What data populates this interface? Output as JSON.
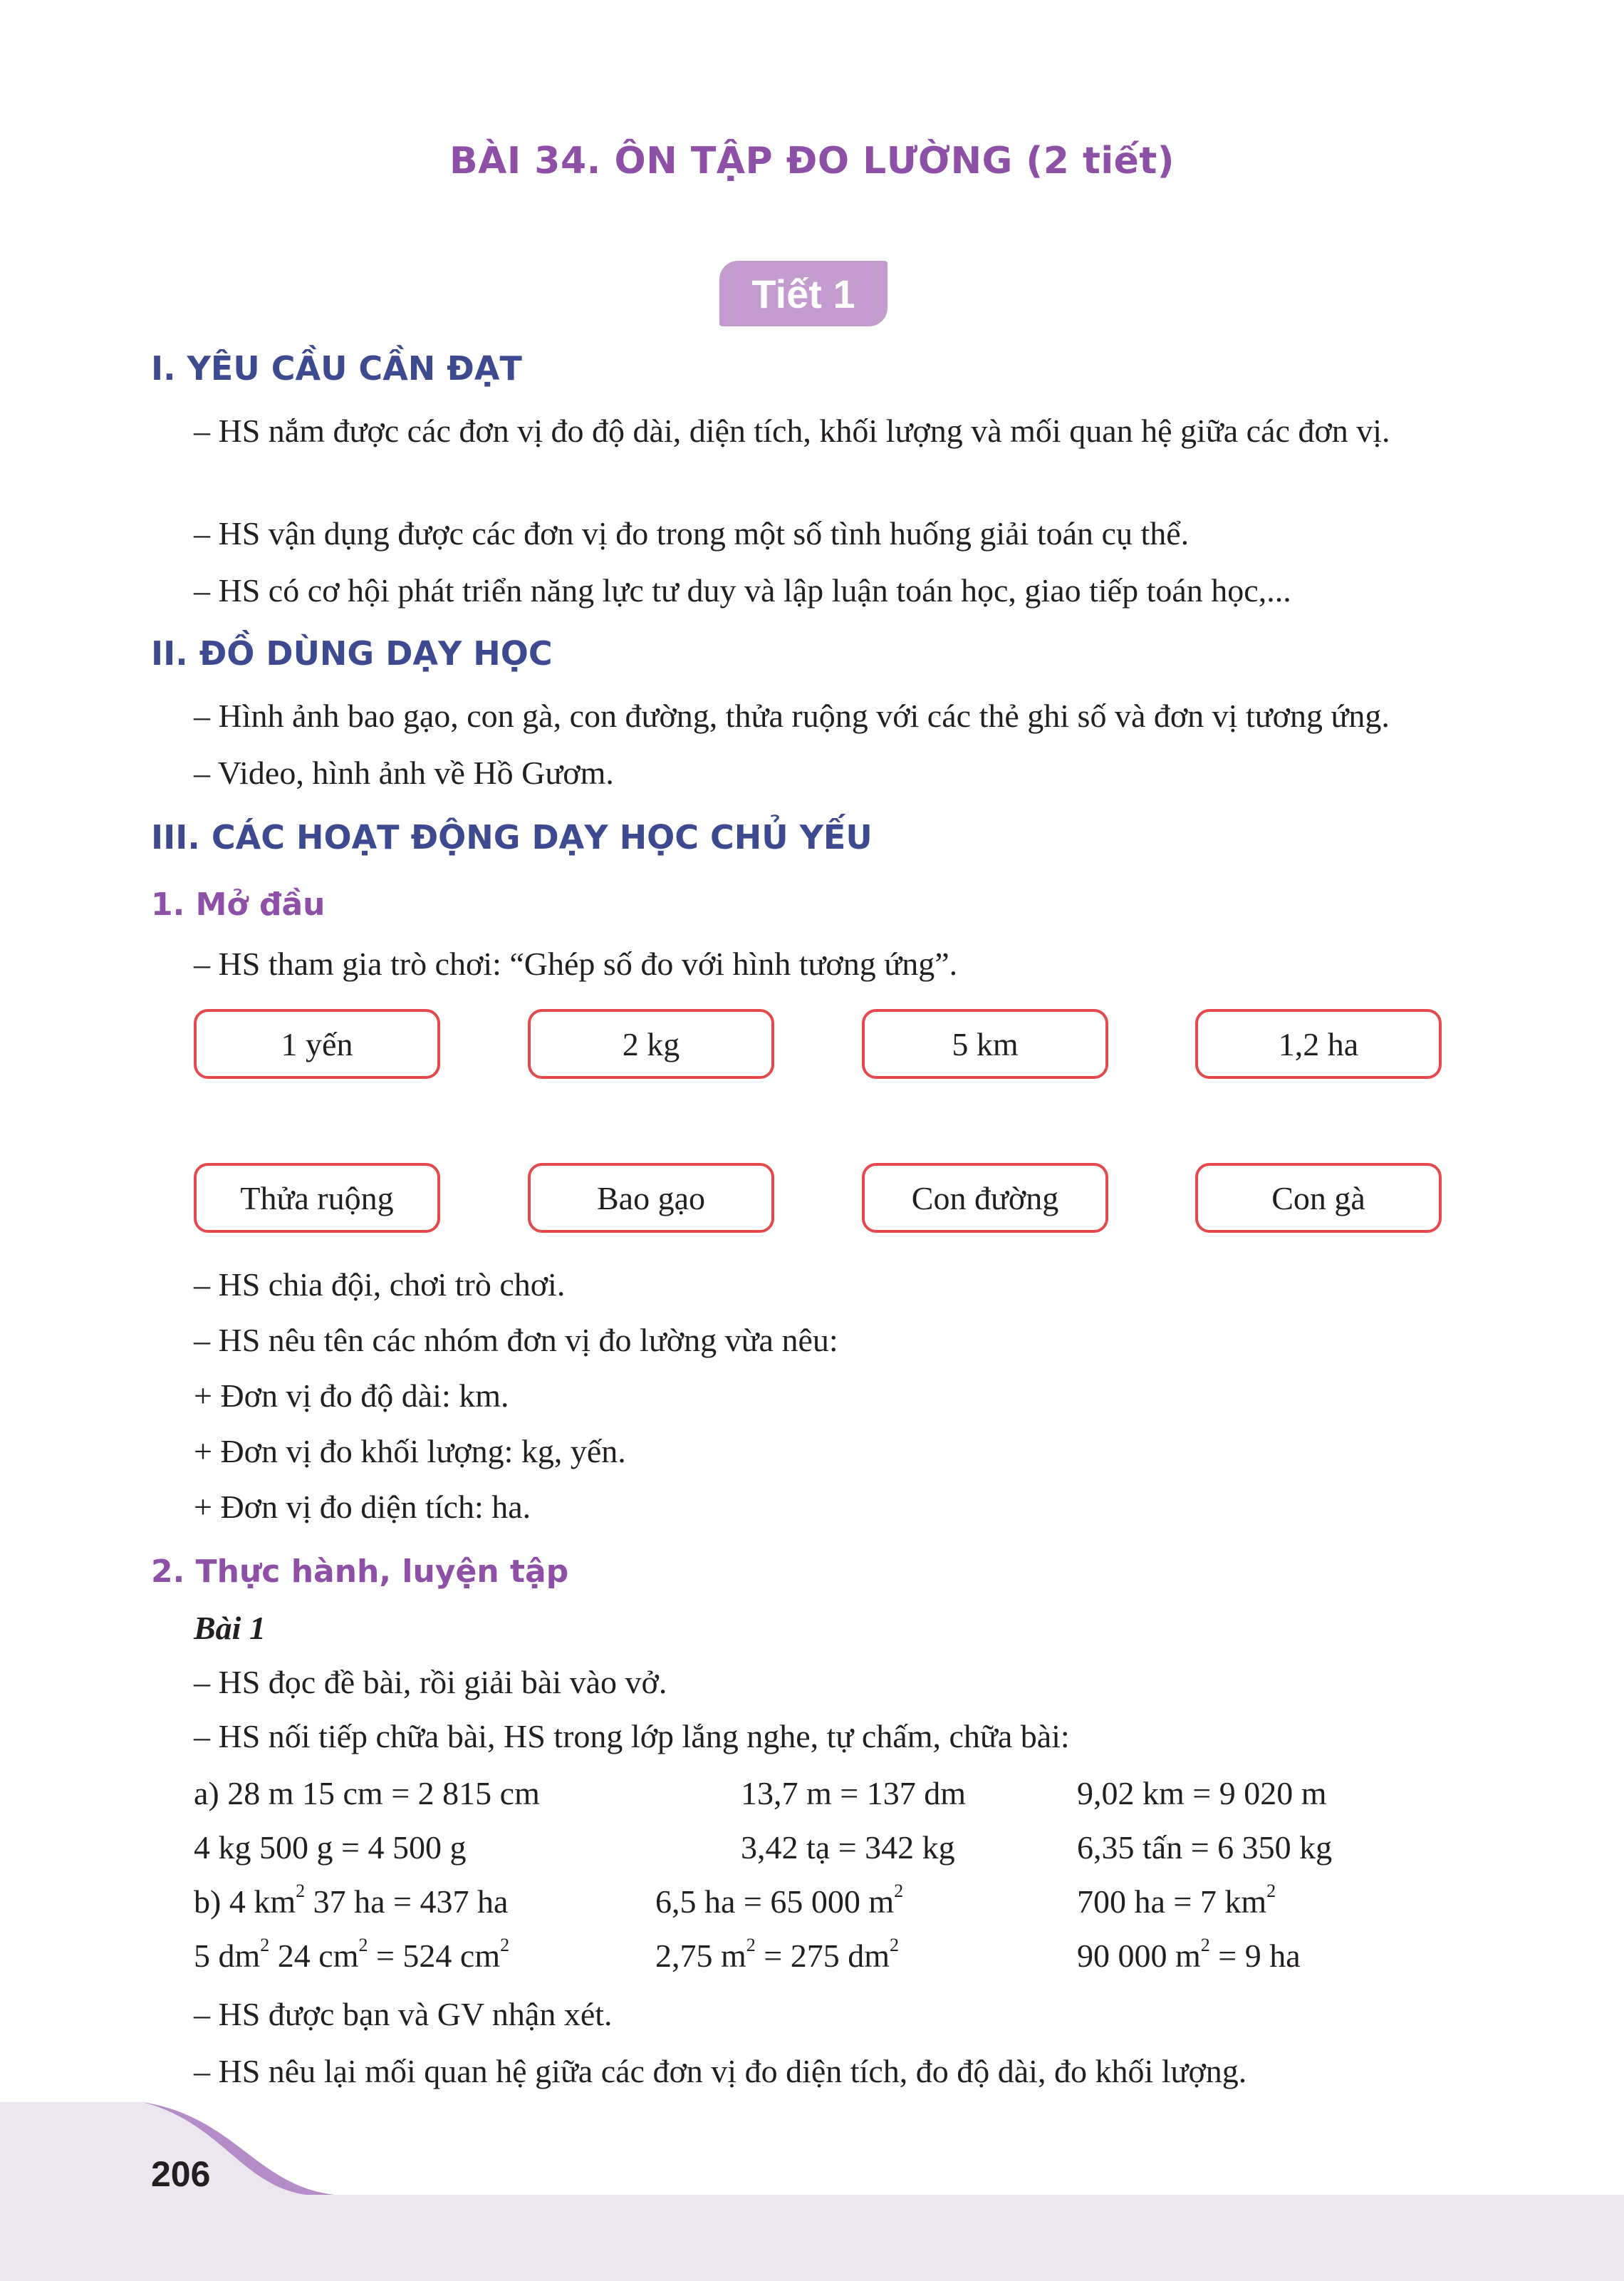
{
  "title": "BÀI 34. ÔN TẬP ĐO LƯỜNG (2 tiết)",
  "tiet": "Tiết 1",
  "sections": {
    "s1": {
      "heading": "I. YÊU CẦU CẦN ĐẠT",
      "lines": [
        "– HS nắm được các đơn vị đo độ dài, diện tích, khối lượng và mối quan hệ giữa các đơn vị.",
        "– HS vận dụng được các đơn vị đo trong một số tình huống giải toán cụ thể.",
        "– HS có cơ hội phát triển năng lực tư duy và lập luận toán học, giao tiếp toán học,..."
      ]
    },
    "s2": {
      "heading": "II. ĐỒ DÙNG DẠY HỌC",
      "lines": [
        "– Hình ảnh bao gạo, con gà, con đường, thửa ruộng với các thẻ ghi số và đơn vị tương ứng.",
        "– Video, hình ảnh về Hồ Gươm."
      ]
    },
    "s3": {
      "heading": "III. CÁC HOẠT ĐỘNG DẠY HỌC CHỦ YẾU"
    }
  },
  "mo_dau": {
    "heading": "1. Mở đầu",
    "intro": "– HS tham gia trò chơi: “Ghép số đo với hình tương ứng”.",
    "cards_top": [
      "1 yến",
      "2 kg",
      "5 km",
      "1,2 ha"
    ],
    "cards_bottom": [
      "Thửa ruộng",
      "Bao gạo",
      "Con đường",
      "Con gà"
    ],
    "after": [
      "– HS chia đội, chơi trò chơi.",
      "– HS nêu tên các nhóm đơn vị đo lường vừa nêu:",
      "+ Đơn vị đo độ dài: km.",
      "+ Đơn vị đo khối lượng: kg, yến.",
      "+ Đơn vị đo diện tích: ha."
    ]
  },
  "thuc_hanh": {
    "heading": "2. Thực hành, luyện tập",
    "bai1": "Bài 1",
    "lines": [
      "– HS đọc đề bài, rồi giải bài vào vở.",
      "– HS nối tiếp chữa bài, HS trong lớp lắng nghe, tự chấm, chữa bài:"
    ],
    "a_row1": [
      "a) 28 m 15 cm = 2 815 cm",
      "13,7 m = 137 dm",
      "9,02 km = 9 020 m"
    ],
    "a_row2": [
      "4 kg 500 g = 4 500 g",
      "3,42 tạ = 342 kg",
      "6,35 tấn = 6 350 kg"
    ],
    "b_row1": {
      "c1": [
        "b) 4 km",
        "2",
        " 37 ha = 437 ha"
      ],
      "c2": [
        "6,5 ha = 65 000 m",
        "2"
      ],
      "c3": [
        "700 ha = 7 km",
        "2"
      ]
    },
    "b_row2": {
      "c1": [
        "5 dm",
        "2",
        " 24 cm",
        "2",
        " = 524 cm",
        "2"
      ],
      "c2": [
        "2,75 m",
        "2",
        " = 275 dm",
        "2"
      ],
      "c3": [
        "90 000 m",
        "2",
        " = 9 ha"
      ]
    },
    "closing": [
      "– HS được bạn và GV nhận xét.",
      "– HS nêu lại mối quan hệ giữa các đơn vị đo diện tích, đo độ dài, đo khối lượng."
    ]
  },
  "page_number": "206"
}
